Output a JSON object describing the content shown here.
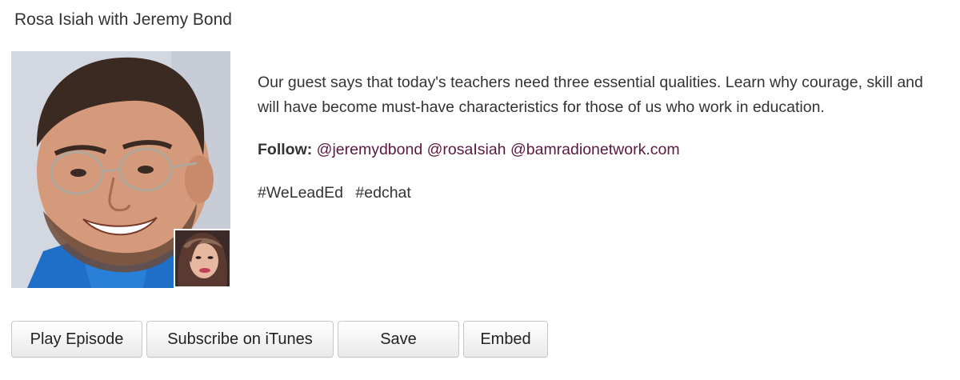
{
  "episode": {
    "title": "Rosa Isiah with Jeremy Bond",
    "description": "Our guest says that today's teachers need three essential qualities. Learn why courage, skill and will have become must-have characteristics for those of us who work in education.",
    "follow_label": "Follow:",
    "follow_handles": [
      "@jeremydbond",
      "@rosaIsiah",
      "@bamradionetwork.com"
    ],
    "hashtags": [
      "#WeLeadEd",
      "#edchat"
    ]
  },
  "actions": {
    "play_label": "Play Episode",
    "subscribe_label": "Subscribe on iTunes",
    "save_label": "Save",
    "embed_label": "Embed"
  },
  "colors": {
    "link": "#5a1a40",
    "text": "#333333",
    "button_border": "#c8c8c8"
  }
}
